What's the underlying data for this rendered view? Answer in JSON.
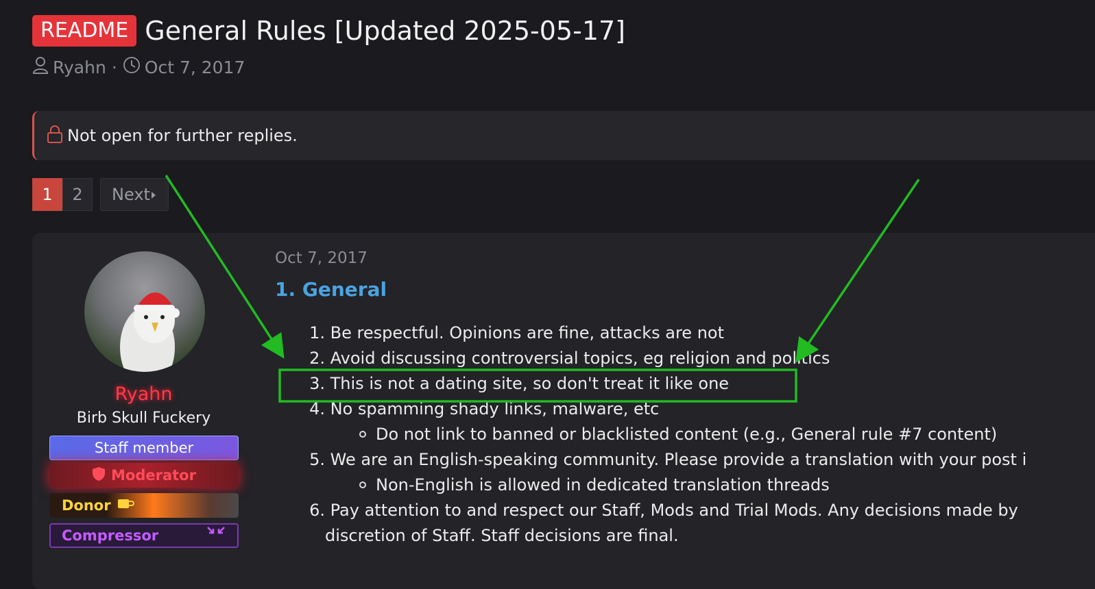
{
  "thread": {
    "prefix": "README",
    "title": "General Rules [Updated 2025-05-17]",
    "author": "Ryahn",
    "separator": "·",
    "date": "Oct 7, 2017"
  },
  "notice": {
    "text": "Not open for further replies."
  },
  "pagination": {
    "pages": [
      "1",
      "2"
    ],
    "current": "1",
    "next_label": "Next"
  },
  "post": {
    "date": "Oct 7, 2017",
    "user": {
      "name": "Ryahn",
      "title": "Birb Skull Fuckery",
      "banners": {
        "staff": "Staff member",
        "moderator": "Moderator",
        "donor": "Donor",
        "compressor": "Compressor"
      }
    },
    "section_heading": "1. General",
    "rules": [
      {
        "num": "1.",
        "text": "Be respectful. Opinions are fine, attacks are not"
      },
      {
        "num": "2.",
        "text": "Avoid discussing controversial topics, eg religion and politics"
      },
      {
        "num": "3.",
        "text": "This is not a dating site, so don't treat it like one"
      },
      {
        "num": "4.",
        "text": "No spamming shady links, malware, etc"
      },
      {
        "sub": "Do not link to banned or blacklisted content (e.g., General rule #7 content)"
      },
      {
        "num": "5.",
        "text": "We are an English-speaking community. Please provide a translation with your post i"
      },
      {
        "sub": "Non-English is allowed in dedicated translation threads"
      },
      {
        "num": "6.",
        "text": "Pay attention to and respect our Staff, Mods and Trial Mods. Any decisions made by"
      },
      {
        "cont": "discretion of Staff. Staff decisions are final."
      }
    ]
  },
  "colors": {
    "accent_red": "#e5333a",
    "link_blue": "#4aa3e0",
    "annotation_green": "#22bb22",
    "background": "#1a1a1f"
  },
  "icons": {
    "author": "user-icon",
    "date": "clock-icon",
    "notice": "lock-icon",
    "next": "caret-right-icon",
    "moderator": "shield-icon",
    "donor": "cup-icon",
    "compressor": "compress-arrows-icon"
  }
}
